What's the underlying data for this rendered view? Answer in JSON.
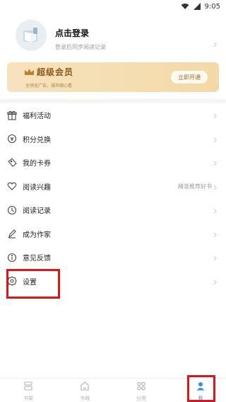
{
  "status_bar": {
    "time": "9:05"
  },
  "profile": {
    "title": "点击登录",
    "subtitle": "登录后同步阅读记录"
  },
  "vip": {
    "title": "超级会员",
    "subtitle": "全场无广告，城市随心看",
    "button_label": "立即开通"
  },
  "menu": [
    {
      "label": "福利活动",
      "icon": "gift-icon",
      "hint": ""
    },
    {
      "label": "积分兑换",
      "icon": "coin-icon",
      "hint": ""
    },
    {
      "label": "我的卡券",
      "icon": "ticket-icon",
      "hint": ""
    },
    {
      "label": "阅读兴趣",
      "icon": "heart-icon",
      "hint": "精准推荐好书"
    },
    {
      "label": "阅读记录",
      "icon": "clock-icon",
      "hint": ""
    },
    {
      "label": "成为作家",
      "icon": "pen-icon",
      "hint": ""
    },
    {
      "label": "意见反馈",
      "icon": "info-icon",
      "hint": ""
    },
    {
      "label": "设置",
      "icon": "gear-icon",
      "hint": ""
    }
  ],
  "tabs": [
    {
      "label": "书架",
      "icon": "bookshelf-icon",
      "active": false
    },
    {
      "label": "书城",
      "icon": "bookstore-icon",
      "active": false
    },
    {
      "label": "分类",
      "icon": "category-icon",
      "active": false
    },
    {
      "label": "我",
      "icon": "profile-icon",
      "active": true
    }
  ],
  "colors": {
    "accent": "#2f8ff3",
    "highlight": "#d9161c",
    "vip_gold": "#f3d9a7"
  }
}
